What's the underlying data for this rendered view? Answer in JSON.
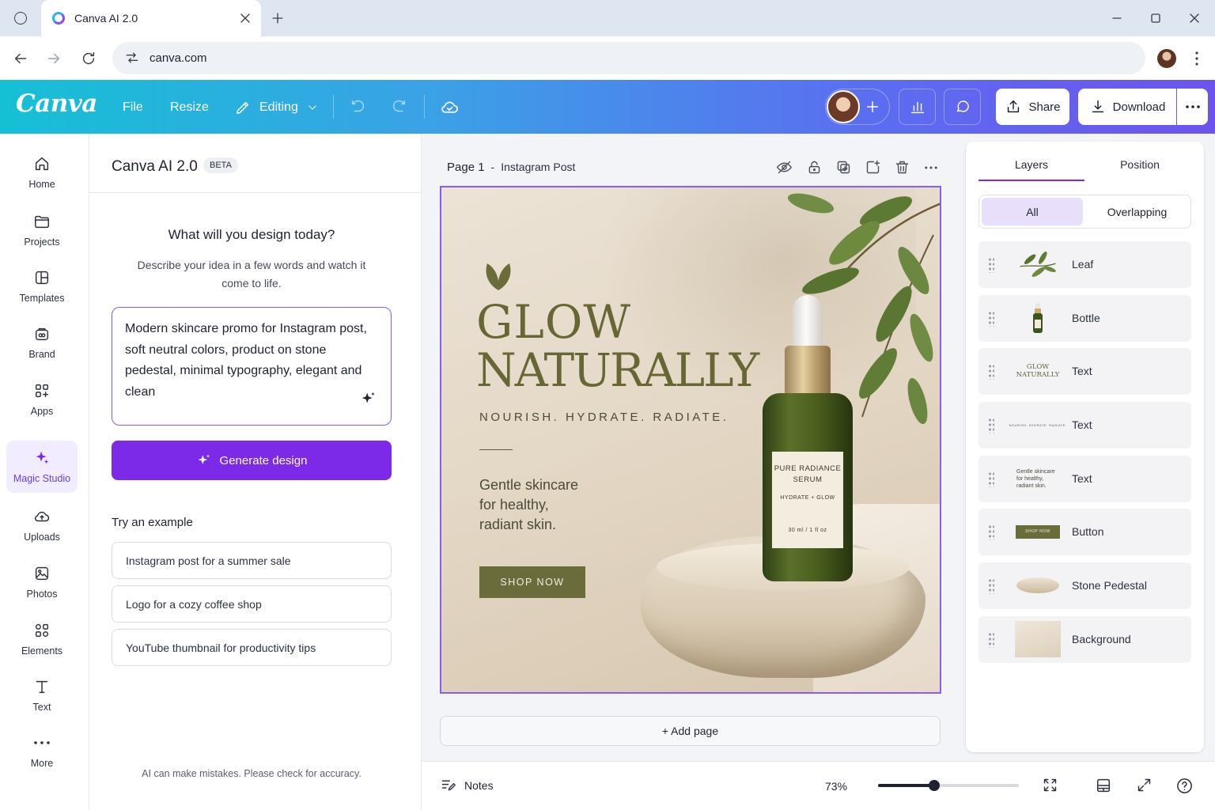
{
  "browser": {
    "tab_title": "Canva AI 2.0",
    "url": "canva.com"
  },
  "header": {
    "logo": "Canva",
    "menu": [
      "File",
      "Resize"
    ],
    "editing_label": "Editing",
    "share_label": "Share",
    "download_label": "Download"
  },
  "rail": {
    "items": [
      {
        "label": "Home",
        "icon": "home-icon"
      },
      {
        "label": "Projects",
        "icon": "folder-icon"
      },
      {
        "label": "Templates",
        "icon": "templates-icon"
      },
      {
        "label": "Brand",
        "icon": "brand-icon"
      },
      {
        "label": "Apps",
        "icon": "apps-icon"
      },
      {
        "label": "Magic Studio",
        "icon": "sparkle-icon",
        "selected": true
      },
      {
        "label": "Uploads",
        "icon": "cloud-upload-icon"
      },
      {
        "label": "Photos",
        "icon": "photo-icon"
      },
      {
        "label": "Elements",
        "icon": "elements-icon"
      },
      {
        "label": "Text",
        "icon": "text-icon"
      },
      {
        "label": "More",
        "icon": "more-icon"
      }
    ]
  },
  "ai_panel": {
    "title": "Canva AI 2.0",
    "badge": "BETA",
    "heading": "What will you design today?",
    "description": "Describe your idea in a few words and watch it come to life.",
    "prompt": "Modern skincare promo for Instagram post, soft neutral colors, product on stone pedestal, minimal typography, elegant and clean",
    "generate_label": "Generate design",
    "examples_title": "Try an example",
    "examples": [
      "Instagram post for a summer sale",
      "Logo for a cozy coffee shop",
      "YouTube thumbnail for productivity tips"
    ],
    "disclaimer": "AI can make mistakes. Please check for accuracy."
  },
  "canvas": {
    "page_label": "Page 1",
    "page_sep": "-",
    "page_type": "Instagram Post",
    "add_page": "+ Add page",
    "notes": "Notes",
    "zoom": "73%",
    "zoom_fraction": 0.4
  },
  "design": {
    "headline_1": "GLOW",
    "headline_2": "NATURALLY",
    "tagline": "NOURISH. HYDRATE. RADIATE.",
    "body": [
      "Gentle skincare",
      "for healthy,",
      "radiant skin."
    ],
    "cta": "SHOP NOW",
    "bottle_label_1": "PURE RADIANCE",
    "bottle_label_2": "SERUM",
    "bottle_label_3": "HYDRATE + GLOW",
    "bottle_label_4": "30 ml / 1 fl oz"
  },
  "layers": {
    "tabs": [
      "Layers",
      "Position"
    ],
    "filters": [
      "All",
      "Overlapping"
    ],
    "items": [
      "Leaf",
      "Bottle",
      "Text",
      "Text",
      "Text",
      "Button",
      "Stone Pedestal",
      "Background"
    ],
    "thumb_text_1": "GLOW NATURALLY",
    "thumb_text_2": "NOURISH. HYDRATE. RADIATE.",
    "thumb_text_3": "Gentle skincare for healthy, radiant skin.",
    "thumb_button": "SHOP NOW"
  },
  "colors": {
    "accent": "#7d2ae8",
    "olive": "#6b6c3b",
    "header_start": "#15c0d5",
    "header_end": "#6d53ee"
  }
}
